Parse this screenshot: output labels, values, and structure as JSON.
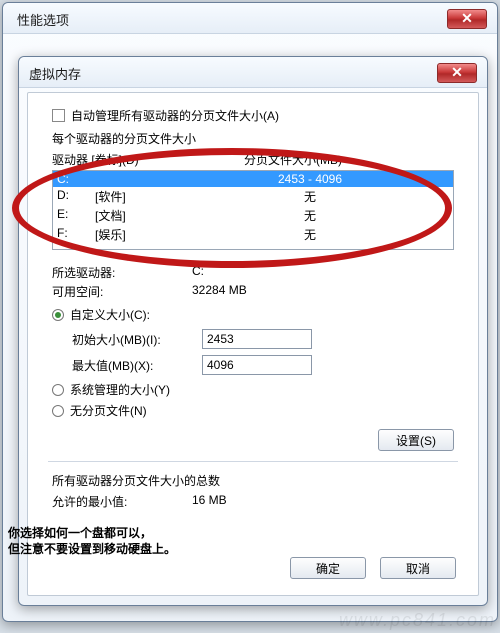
{
  "win1": {
    "title": "性能选项"
  },
  "win2": {
    "title": "虚拟内存"
  },
  "autoManage": {
    "label": "自动管理所有驱动器的分页文件大小(A)"
  },
  "perDriveHeader": "每个驱动器的分页文件大小",
  "colDrive": "驱动器 [卷标](D)",
  "colPageFile": "分页文件大小(MB)",
  "drives": [
    {
      "letter": "C:",
      "label": "",
      "size": "2453 - 4096"
    },
    {
      "letter": "D:",
      "label": "[软件]",
      "size": "无"
    },
    {
      "letter": "E:",
      "label": "[文档]",
      "size": "无"
    },
    {
      "letter": "F:",
      "label": "[娱乐]",
      "size": "无"
    }
  ],
  "selDriveLbl": "所选驱动器:",
  "selDriveVal": "C:",
  "availLbl": "可用空间:",
  "availVal": "32284 MB",
  "customLbl": "自定义大小(C):",
  "initLbl": "初始大小(MB)(I):",
  "initVal": "2453",
  "maxLbl": "最大值(MB)(X):",
  "maxVal": "4096",
  "sysManagedLbl": "系统管理的大小(Y)",
  "noPagingLbl": "无分页文件(N)",
  "setBtn": "设置(S)",
  "totalHeader": "所有驱动器分页文件大小的总数",
  "minAllowLbl": "允许的最小值:",
  "minAllowVal": "16 MB",
  "okBtn": "确定",
  "cancelBtn": "取消",
  "annotation1": "你选择如何一个盘都可以，",
  "annotation2": "但注意不要设置到移动硬盘上。",
  "watermark": "www.pc841.com"
}
